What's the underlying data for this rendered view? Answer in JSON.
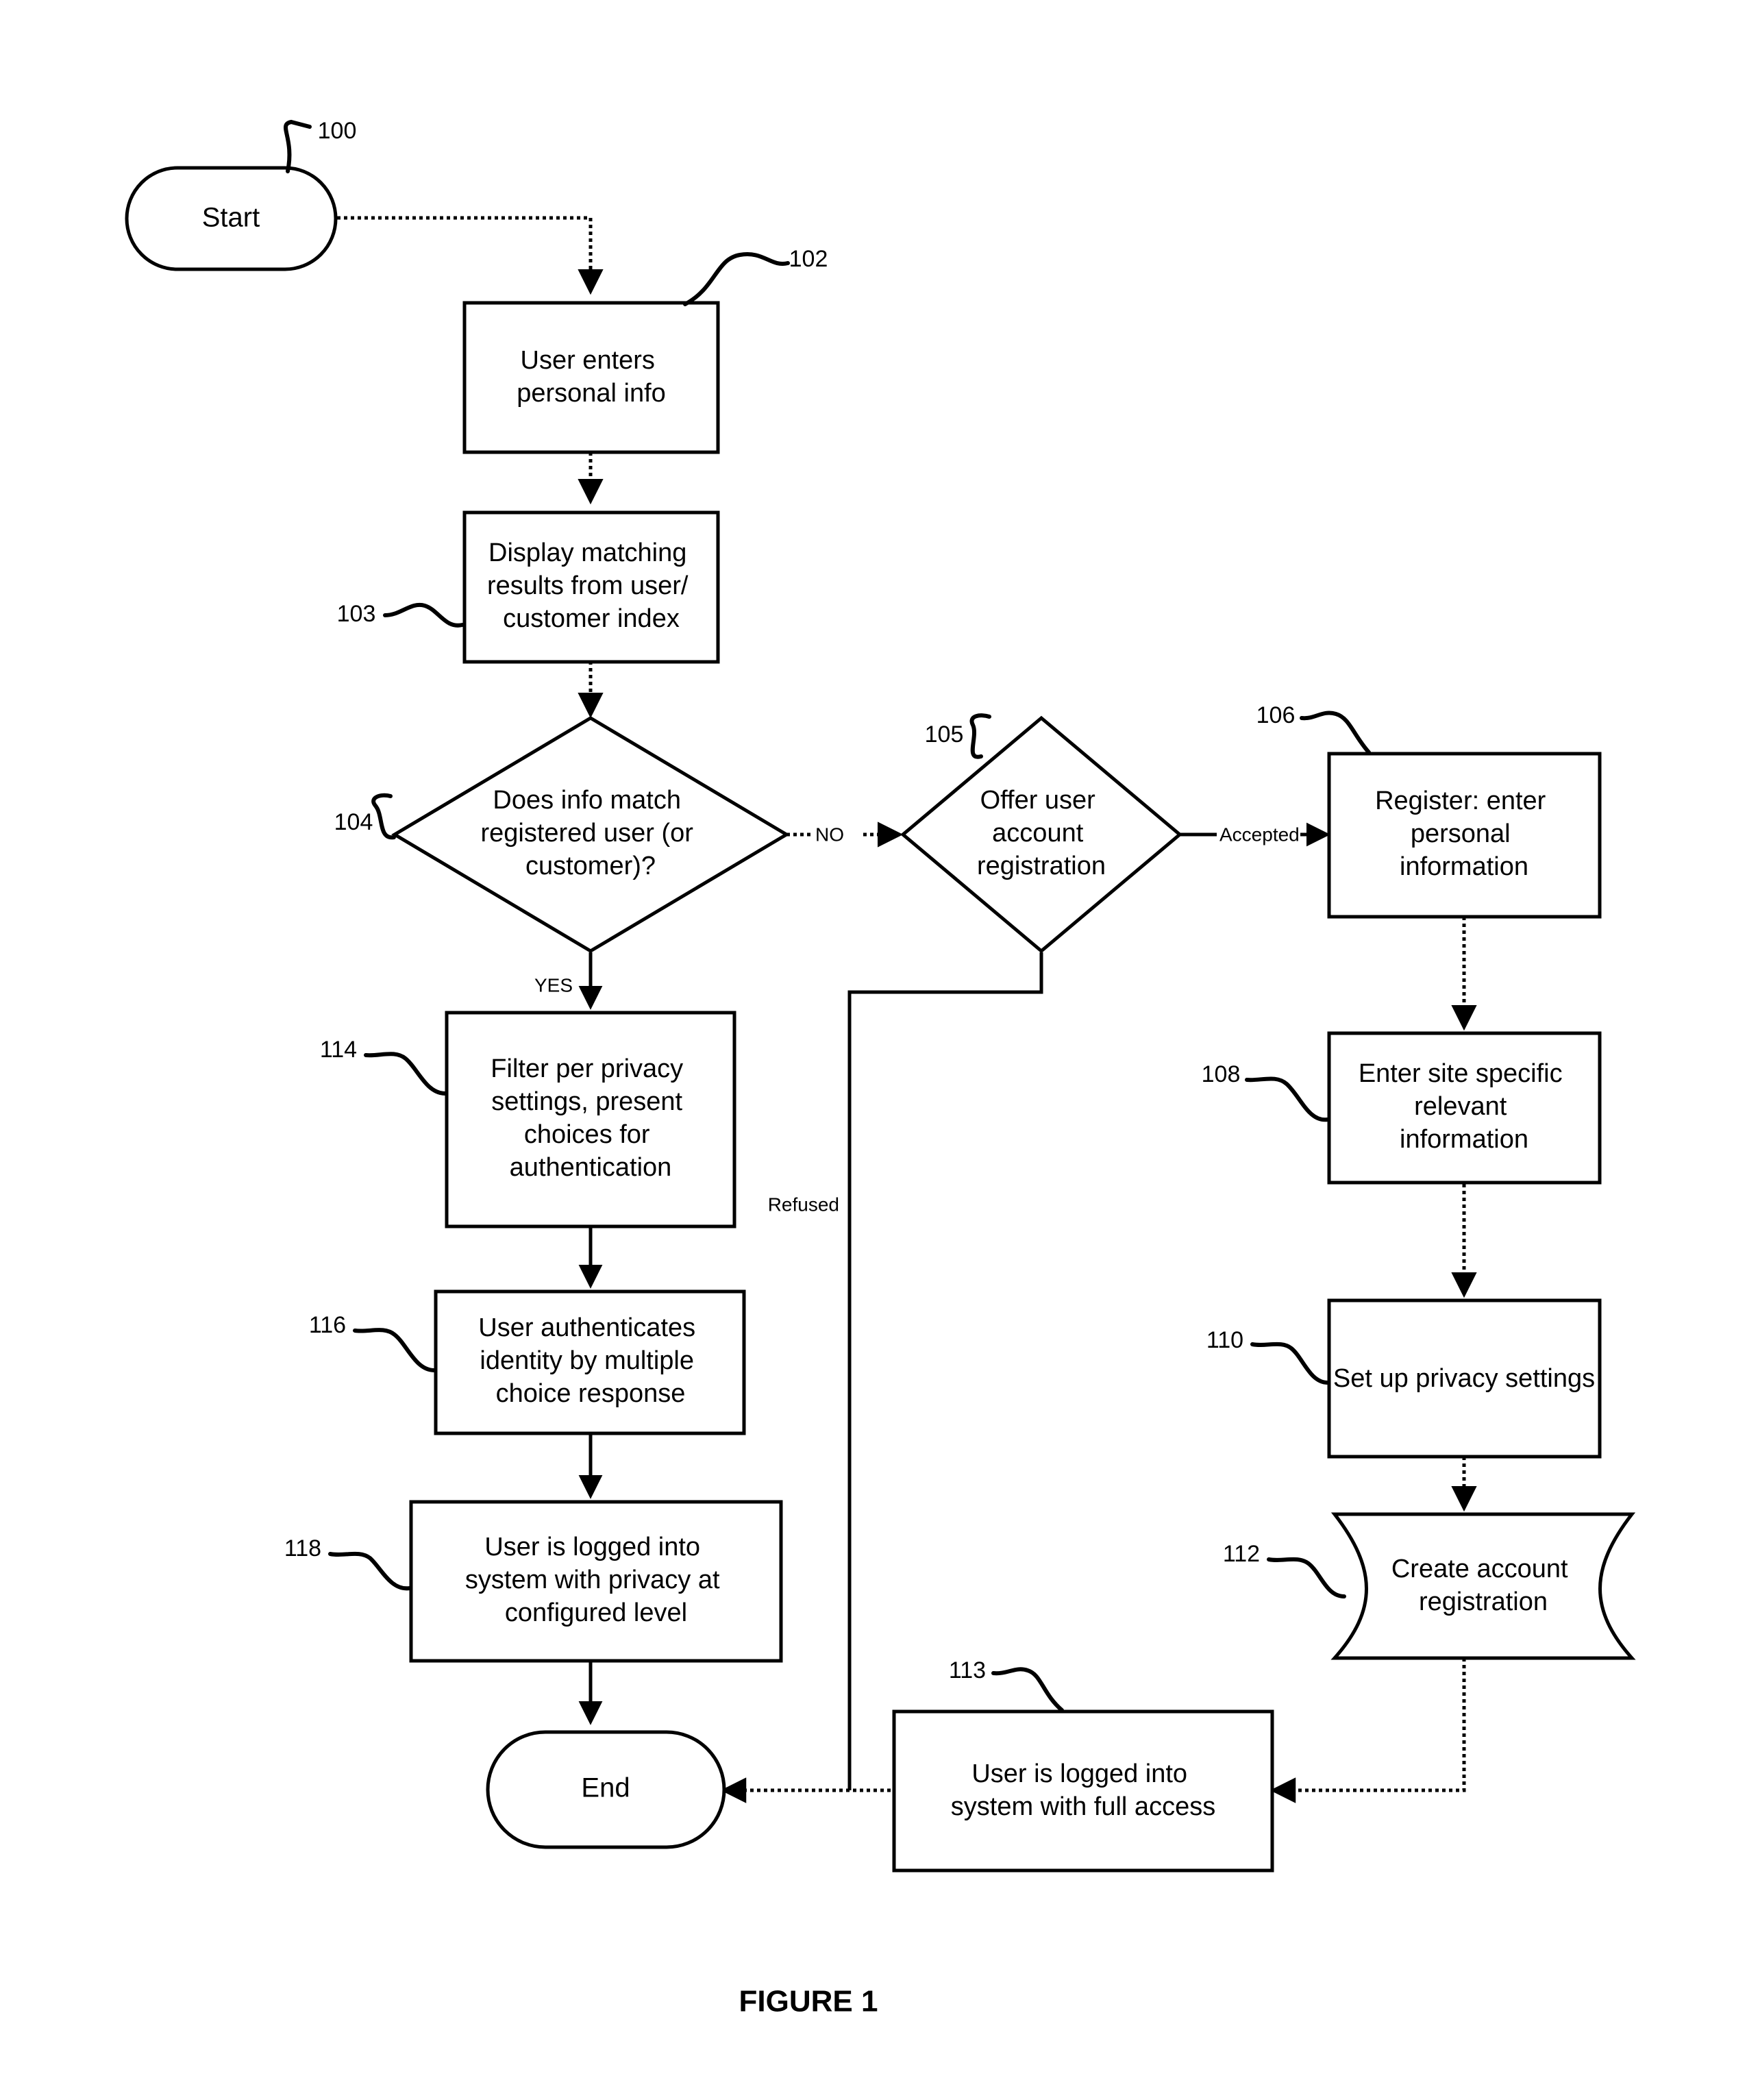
{
  "figure": {
    "caption": "FIGURE 1"
  },
  "nodes": {
    "start": {
      "ref": "100",
      "label": "Start",
      "shape": "terminator"
    },
    "n102": {
      "ref": "102",
      "label": "User enters personal info",
      "lines": [
        "User enters",
        "personal info"
      ],
      "shape": "process"
    },
    "n103": {
      "ref": "103",
      "label": "Display matching results from user/ customer index",
      "lines": [
        "Display matching",
        "results from user/",
        "customer index"
      ],
      "shape": "process"
    },
    "n104": {
      "ref": "104",
      "label": "Does info match registered user (or customer)?",
      "lines": [
        "Does info match",
        "registered user (or",
        "customer)?"
      ],
      "shape": "decision"
    },
    "n105": {
      "ref": "105",
      "label": "Offer user account registration",
      "lines": [
        "Offer user",
        "account",
        "registration"
      ],
      "shape": "decision"
    },
    "n106": {
      "ref": "106",
      "label": "Register: enter personal information",
      "lines": [
        "Register: enter",
        "personal",
        "information"
      ],
      "shape": "process"
    },
    "n108": {
      "ref": "108",
      "label": "Enter site specific relevant information",
      "lines": [
        "Enter site specific",
        "relevant",
        "information"
      ],
      "shape": "process"
    },
    "n110": {
      "ref": "110",
      "label": "Set up privacy settings",
      "lines": [
        "Set up privacy settings"
      ],
      "shape": "process"
    },
    "n112": {
      "ref": "112",
      "label": "Create account registration",
      "lines": [
        "Create account",
        "registration"
      ],
      "shape": "stored-data"
    },
    "n113": {
      "ref": "113",
      "label": "User is logged into system with full access",
      "lines": [
        "User is logged into",
        "system with full access"
      ],
      "shape": "process"
    },
    "n114": {
      "ref": "114",
      "label": "Filter per privacy settings, present choices for authentication",
      "lines": [
        "Filter per privacy",
        "settings, present",
        "choices for",
        "authentication"
      ],
      "shape": "process"
    },
    "n116": {
      "ref": "116",
      "label": "User authenticates identity by multiple choice response",
      "lines": [
        "User authenticates",
        "identity by multiple",
        "choice response"
      ],
      "shape": "process"
    },
    "n118": {
      "ref": "118",
      "label": "User is logged into system with privacy at configured level",
      "lines": [
        "User is logged into",
        "system with privacy at",
        "configured level"
      ],
      "shape": "process"
    },
    "end": {
      "label": "End",
      "shape": "terminator"
    }
  },
  "edges": {
    "start_to_102": {
      "label": "",
      "style": "dotted"
    },
    "102_to_103": {
      "label": "",
      "style": "dotted"
    },
    "103_to_104": {
      "label": "",
      "style": "dotted"
    },
    "104_to_105": {
      "label": "NO",
      "style": "dotted"
    },
    "104_to_114": {
      "label": "YES",
      "style": "solid"
    },
    "105_to_106": {
      "label": "Accepted",
      "style": "solid"
    },
    "105_to_end": {
      "label": "Refused",
      "style": "solid"
    },
    "106_to_108": {
      "label": "",
      "style": "dotted"
    },
    "108_to_110": {
      "label": "",
      "style": "dotted"
    },
    "110_to_112": {
      "label": "",
      "style": "dotted"
    },
    "112_to_113": {
      "label": "",
      "style": "dotted"
    },
    "113_to_end": {
      "label": "",
      "style": "dotted"
    },
    "114_to_116": {
      "label": "",
      "style": "solid"
    },
    "116_to_118": {
      "label": "",
      "style": "solid"
    },
    "118_to_end": {
      "label": "",
      "style": "solid"
    }
  },
  "colors": {
    "background": "#ffffff",
    "stroke": "#000000",
    "text": "#000000"
  }
}
